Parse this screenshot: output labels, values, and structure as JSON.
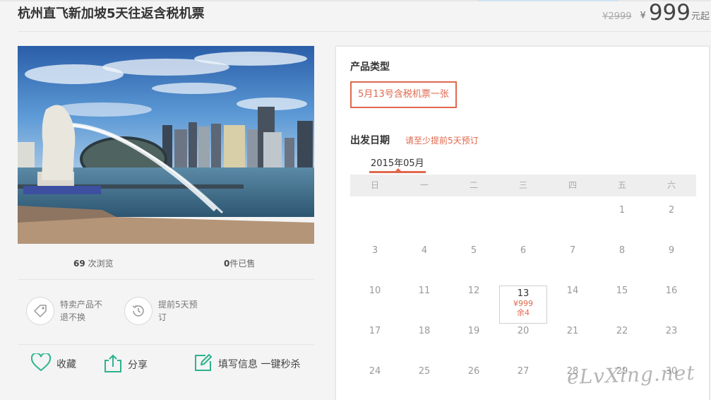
{
  "product": {
    "title": "杭州直飞新加坡5天往返含税机票",
    "old_price": "¥2999",
    "currency": "¥",
    "price": "999",
    "price_unit": "元起"
  },
  "stats": {
    "views": "69",
    "views_label": "次浏览",
    "sold": "0",
    "sold_label": "件已售"
  },
  "features": [
    {
      "icon": "tag-icon",
      "text": "特卖产品不退不换"
    },
    {
      "icon": "history-icon",
      "text": "提前5天预订"
    }
  ],
  "actions": {
    "favorite": "收藏",
    "share": "分享",
    "book": "填写信息 一键秒杀"
  },
  "booking": {
    "product_type_label": "产品类型",
    "product_type_option": "5月13号含税机票一张",
    "departure_label": "出发日期",
    "departure_note": "请至少提前5天预订",
    "month": "2015年05月",
    "weekdays": [
      "日",
      "一",
      "二",
      "三",
      "四",
      "五",
      "六"
    ],
    "selected_day": {
      "day": "13",
      "price": "¥999",
      "remaining": "余4"
    }
  },
  "calendar_days": [
    "",
    "",
    "",
    "",
    "",
    "1",
    "2",
    "3",
    "4",
    "5",
    "6",
    "7",
    "8",
    "9",
    "10",
    "11",
    "12",
    "13",
    "14",
    "15",
    "16",
    "17",
    "18",
    "19",
    "20",
    "21",
    "22",
    "23",
    "24",
    "25",
    "26",
    "27",
    "28",
    "29",
    "30"
  ],
  "watermark": "eLvXing.net",
  "colors": {
    "accent": "#e0684d",
    "green_icon": "#2bb38f"
  }
}
